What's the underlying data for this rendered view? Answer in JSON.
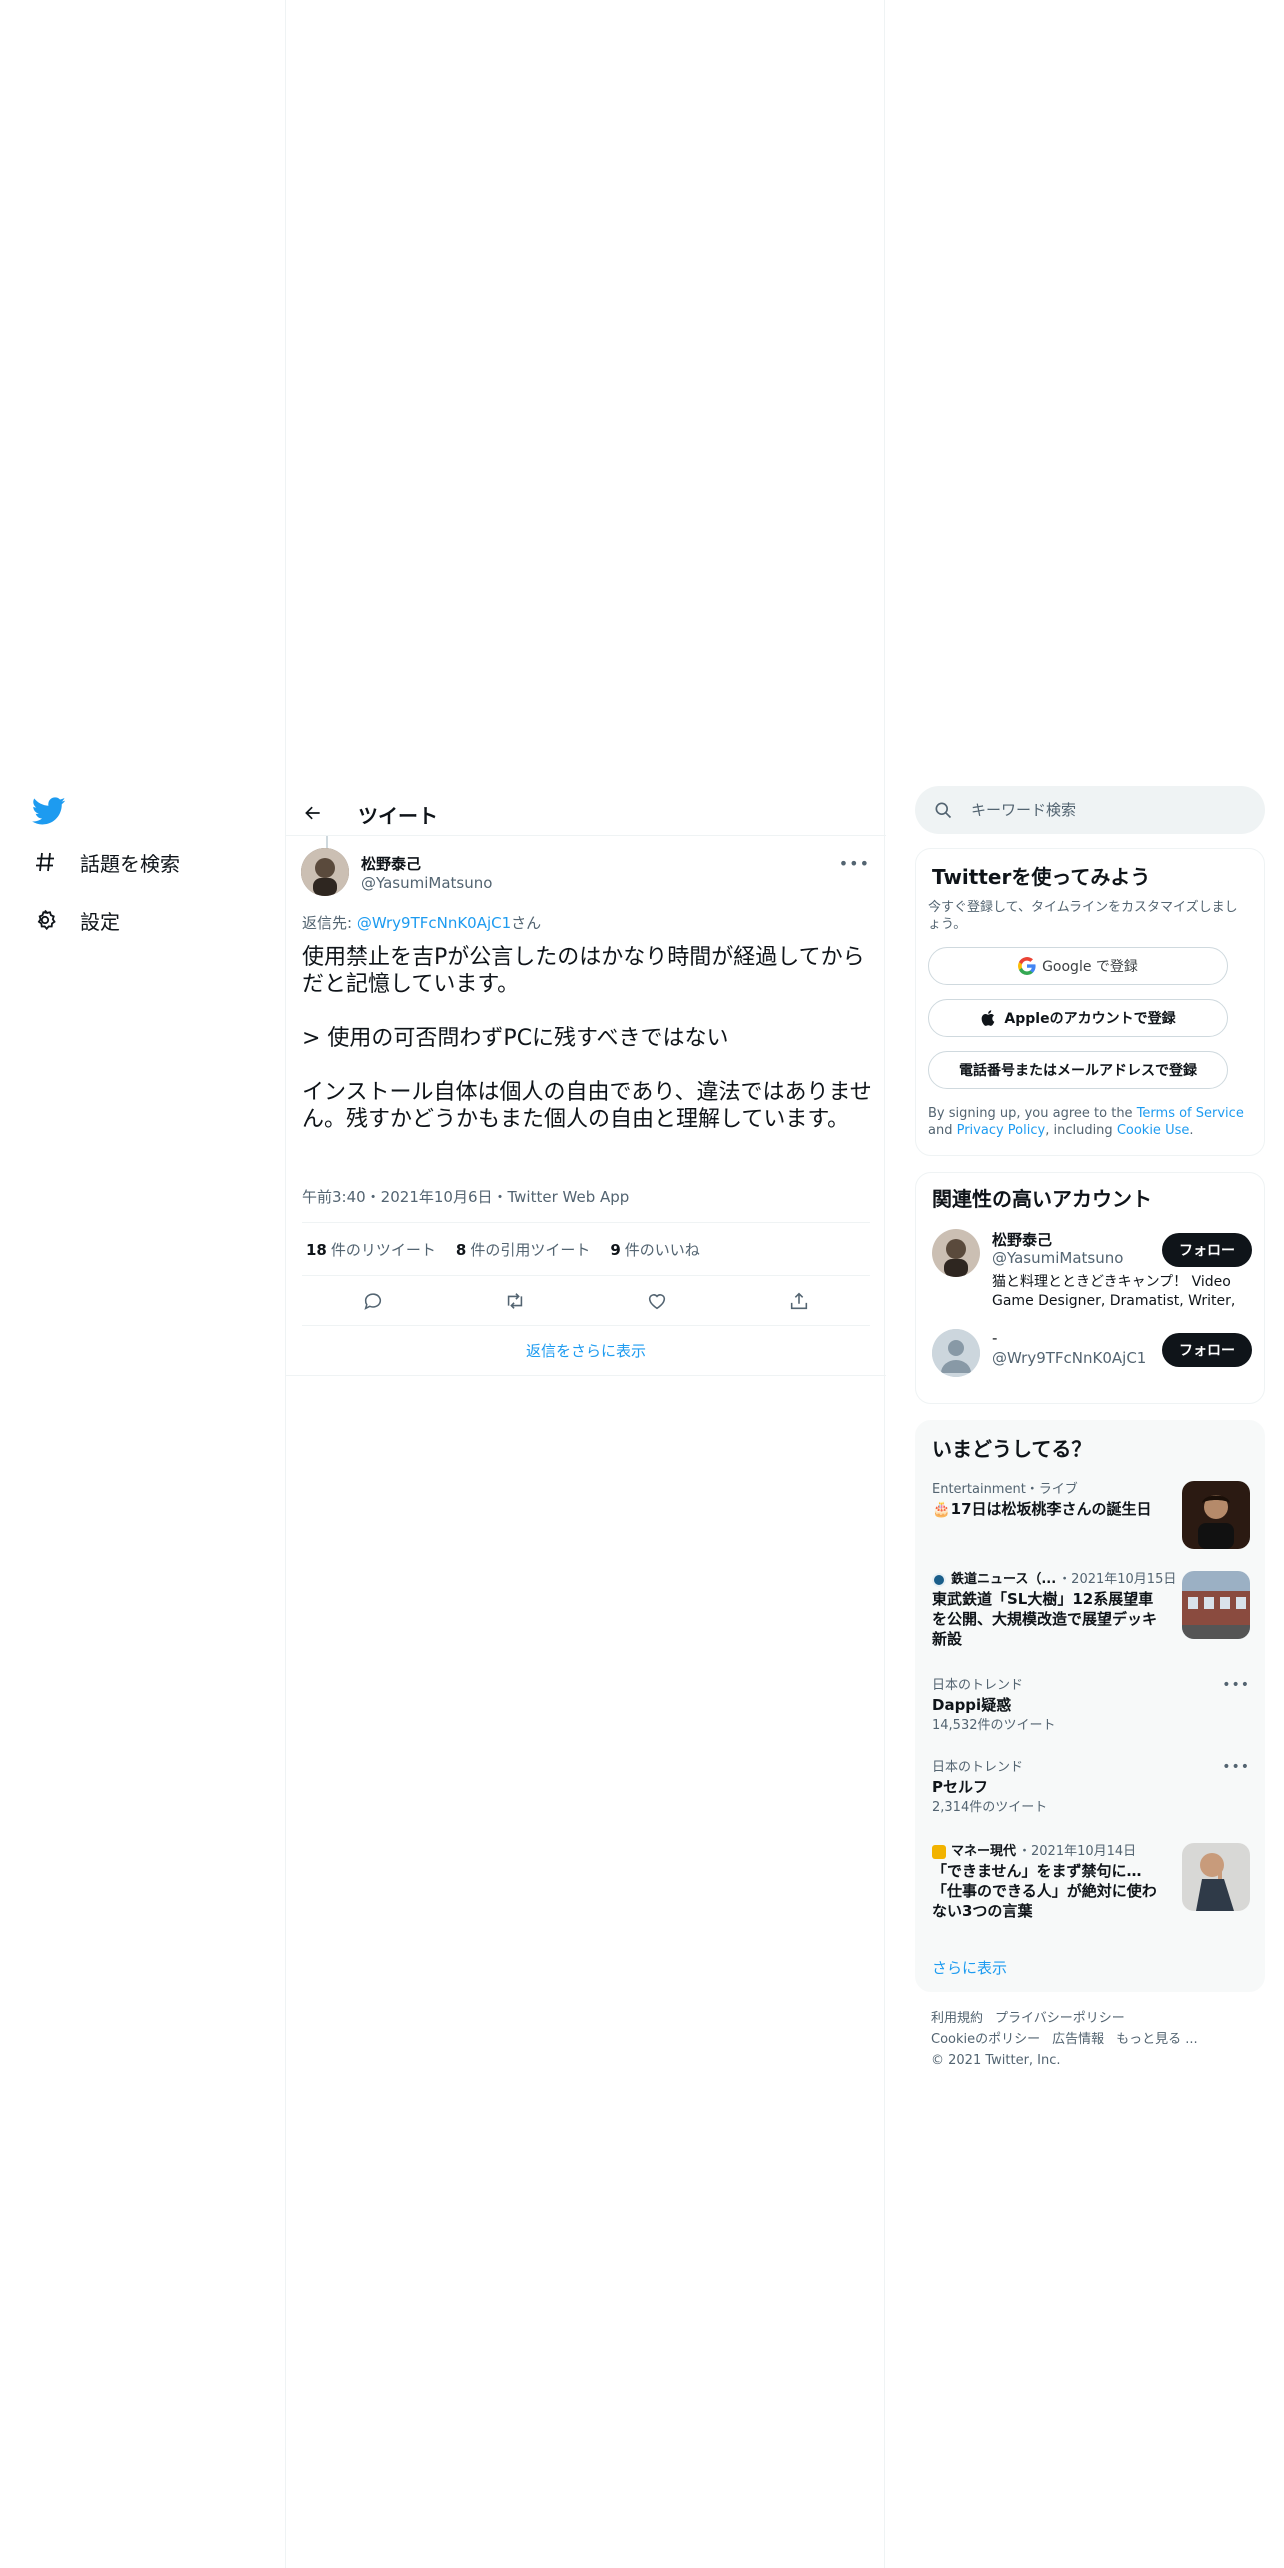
{
  "nav": {
    "items": [
      {
        "label": "話題を検索",
        "icon": "hashtag-icon"
      },
      {
        "label": "設定",
        "icon": "gear-icon"
      }
    ]
  },
  "header": {
    "title": "ツイート"
  },
  "tweet": {
    "author_name": "松野泰己",
    "author_handle": "@YasumiMatsuno",
    "reply_prefix": "返信先: ",
    "reply_mention": "@Wry9TFcNnK0AjC1",
    "reply_suffix": "さん",
    "text": "使用禁止を吉Pが公言したのはかなり時間が経過してからだと記憶しています。\n\n> 使用の可否問わずPCに残すべきではない\n\nインストール自体は個人の自由であり、違法ではありません。残すかどうかもまた個人の自由と理解しています。",
    "meta": "午前3:40・2021年10月6日・Twitter Web App",
    "stats": {
      "retweets": "18",
      "retweets_label": "件のリツイート",
      "quotes": "8",
      "quotes_label": "件の引用ツイート",
      "likes": "9",
      "likes_label": "件のいいね"
    },
    "show_more_replies": "返信をさらに表示"
  },
  "search": {
    "placeholder": "キーワード検索"
  },
  "signup": {
    "title": "Twitterを使ってみよう",
    "subtitle": "今すぐ登録して、タイムラインをカスタマイズしましょう。",
    "google_label": "Google で登録",
    "apple_label": "Appleのアカウントで登録",
    "phone_label": "電話番号またはメールアドレスで登録",
    "legal_1": "By signing up, you agree to the ",
    "terms": "Terms of Service",
    "legal_2": " and ",
    "privacy": "Privacy Policy",
    "legal_3": ", including ",
    "cookie": "Cookie Use",
    "legal_4": "."
  },
  "related": {
    "title": "関連性の高いアカウント",
    "accounts": [
      {
        "name": "松野泰己",
        "handle": "@YasumiMatsuno",
        "bio": "猫と料理とときどきキャンプ！ Video Game Designer, Dramatist, Writer,",
        "follow": "フォロー"
      },
      {
        "name": "-",
        "handle": "@Wry9TFcNnK0AjC1",
        "bio": "",
        "follow": "フォロー"
      }
    ]
  },
  "trends": {
    "title": "いまどうしてる？",
    "items": [
      {
        "context": "Entertainment・ライブ",
        "title": "🎂17日は松坂桃李さんの誕生日"
      },
      {
        "source": "鉄道ニュース（...",
        "context": "・2021年10月15日",
        "title": "東武鉄道「SL大樹」12系展望車を公開、大規模改造で展望デッキ新設"
      },
      {
        "context": "日本のトレンド",
        "title": "Dappi疑惑",
        "count": "14,532件のツイート"
      },
      {
        "context": "日本のトレンド",
        "title": "Pセルフ",
        "count": "2,314件のツイート"
      },
      {
        "source": "マネー現代",
        "context": "・2021年10月14日",
        "title": "「できません」をまず禁句に…「仕事のできる人」が絶対に使わない3つの言葉"
      }
    ],
    "show_more": "さらに表示"
  },
  "footer": {
    "links": [
      "利用規約",
      "プライバシーポリシー",
      "Cookieのポリシー",
      "広告情報",
      "もっと見る ..."
    ],
    "copyright": "© 2021 Twitter, Inc."
  },
  "colors": {
    "accent": "#1d9bf0",
    "text": "#0f1419",
    "secondary": "#536471",
    "border": "#eff3f4"
  }
}
